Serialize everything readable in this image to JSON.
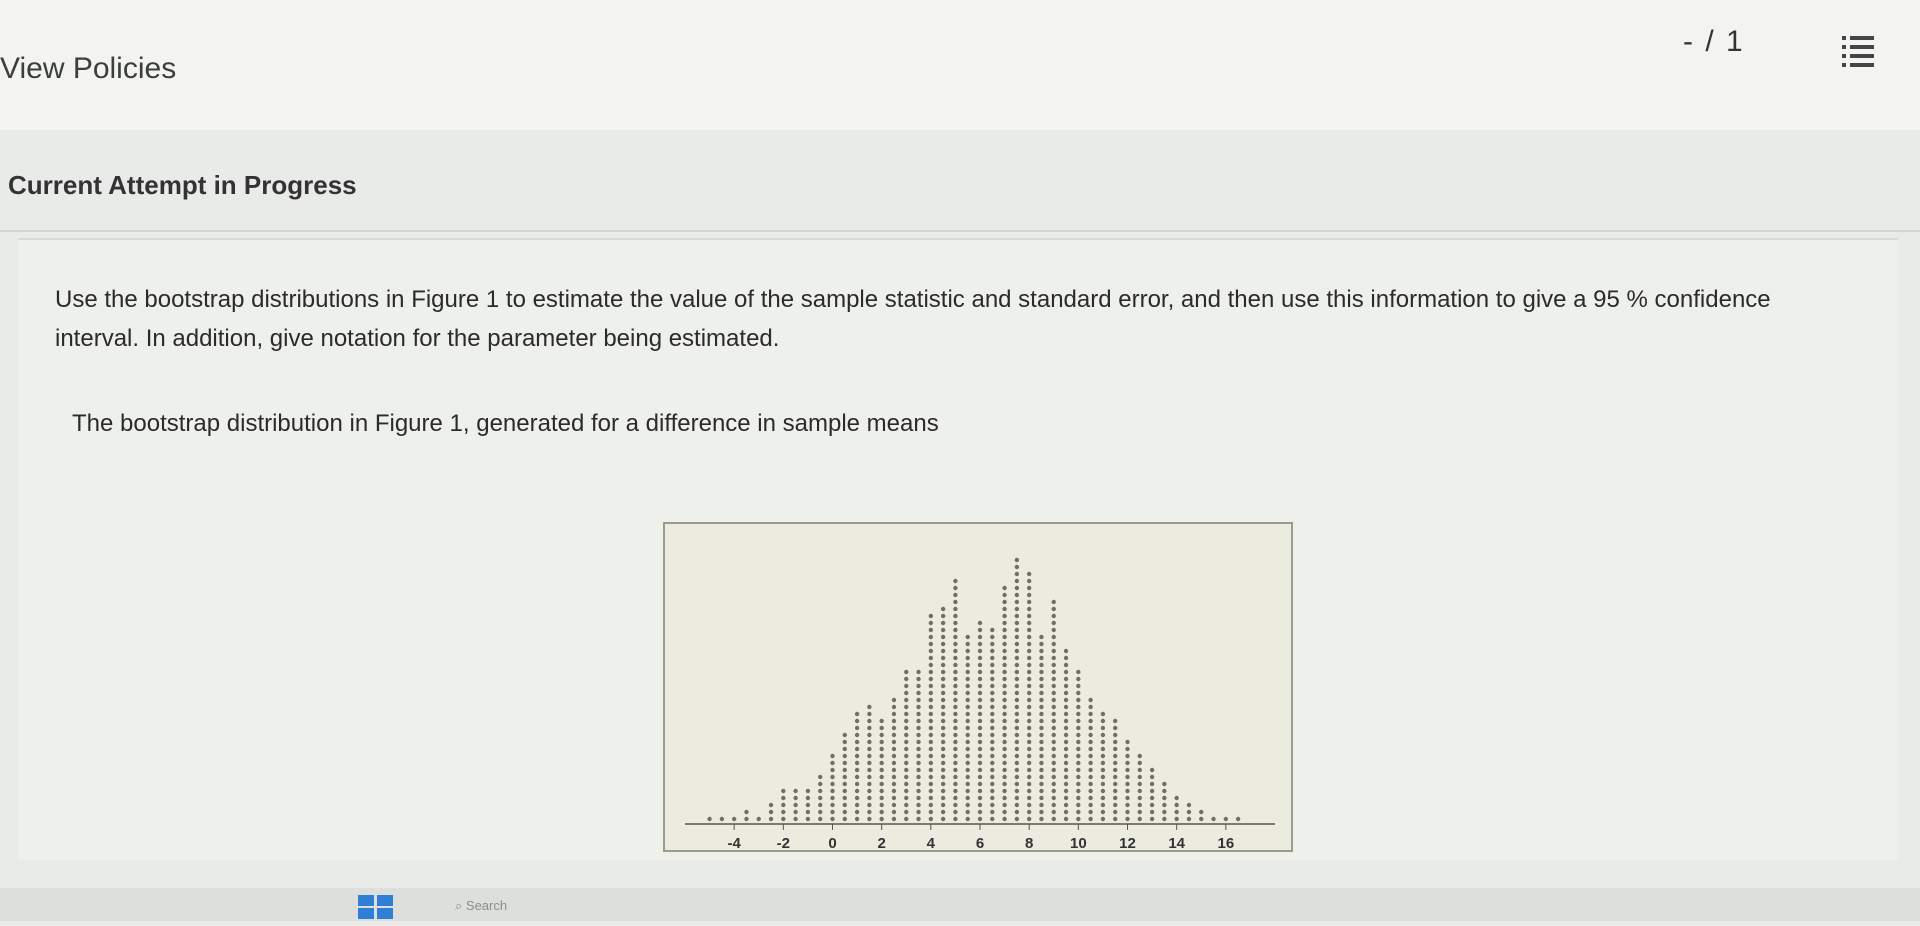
{
  "header": {
    "view_policies_label": "View Policies",
    "score": "- / 1",
    "menu_icon": "list-icon"
  },
  "attempt": {
    "title": "Current Attempt in Progress"
  },
  "question": {
    "text": "Use the bootstrap distributions in Figure 1 to estimate the value of the sample statistic and standard error, and then use this information to give a 95 % confidence interval. In addition, give notation for the parameter being estimated.",
    "subtext": "The bootstrap distribution in Figure 1, generated for a difference in sample means"
  },
  "chart_data": {
    "type": "scatter",
    "title": "",
    "xlabel": "",
    "ylabel": "",
    "xlim": [
      -6,
      18
    ],
    "x_ticks": [
      -4,
      -2,
      0,
      2,
      4,
      6,
      8,
      10,
      12,
      14,
      16
    ],
    "x_tick_labels": [
      "-4",
      "-2",
      "0",
      "2",
      "4",
      "6",
      "8",
      "10",
      "12",
      "14",
      "16"
    ],
    "dotplot_counts": {
      "x": [
        -5,
        -4.5,
        -4,
        -3.5,
        -3,
        -2.5,
        -2,
        -1.5,
        -1,
        -0.5,
        0,
        0.5,
        1,
        1.5,
        2,
        2.5,
        3,
        3.5,
        4,
        4.5,
        5,
        5.5,
        6,
        6.5,
        7,
        7.5,
        8,
        8.5,
        9,
        9.5,
        10,
        10.5,
        11,
        11.5,
        12,
        12.5,
        13,
        13.5,
        14,
        14.5,
        15,
        15.5,
        16,
        16.5
      ],
      "count": [
        1,
        1,
        1,
        2,
        1,
        3,
        5,
        5,
        5,
        7,
        10,
        13,
        16,
        17,
        15,
        18,
        22,
        22,
        30,
        31,
        35,
        27,
        29,
        28,
        34,
        38,
        36,
        27,
        32,
        25,
        22,
        18,
        16,
        15,
        12,
        10,
        8,
        6,
        4,
        3,
        2,
        1,
        1,
        1
      ]
    },
    "grid": false,
    "legend": "none"
  },
  "taskbar": {
    "start_icon": "windows-icon",
    "search_placeholder": "Search"
  }
}
